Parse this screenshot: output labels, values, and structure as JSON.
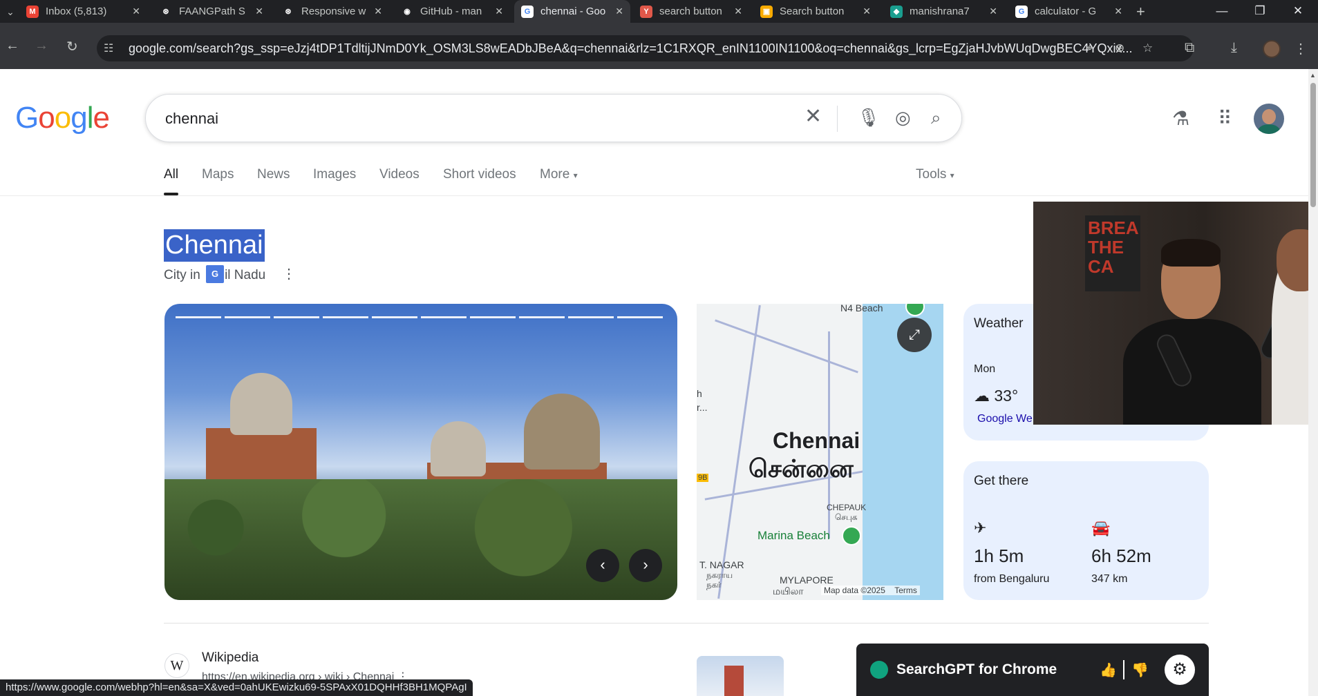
{
  "browser": {
    "tabs": [
      {
        "title": "Inbox (5,813)",
        "icon": "gmail-icon",
        "color": "#ea4335",
        "glyph": "M"
      },
      {
        "title": "FAANGPath S",
        "icon": "chatgpt-icon",
        "color": "#202124",
        "glyph": "⊛"
      },
      {
        "title": "Responsive w",
        "icon": "chatgpt-icon",
        "color": "#202124",
        "glyph": "⊛"
      },
      {
        "title": "GitHub - man",
        "icon": "github-icon",
        "color": "#202124",
        "glyph": "◉"
      },
      {
        "title": "chennai - Goo",
        "icon": "google-icon",
        "color": "#ffffff",
        "glyph": "G"
      },
      {
        "title": "search button",
        "icon": "y-icon",
        "color": "#e0584a",
        "glyph": "Y"
      },
      {
        "title": "Search button",
        "icon": "image-icon",
        "color": "#f9ab00",
        "glyph": "▣"
      },
      {
        "title": "manishrana7",
        "icon": "diamond-icon",
        "color": "#1a9e8f",
        "glyph": "◆"
      },
      {
        "title": "calculator - G",
        "icon": "google-icon",
        "color": "#ffffff",
        "glyph": "G"
      }
    ],
    "url": "google.com/search?gs_ssp=eJzj4tDP1TdltijJNmD0Yk_OSM3LS8wEADbJBeA&q=chennai&rlz=1C1RXQR_enIN1100IN1100&oq=chennai&gs_lcrp=EgZjaHJvbWUqDwgBEC4YQxix..."
  },
  "google": {
    "logo": "Google",
    "query": "chennai",
    "tabs": [
      "All",
      "Maps",
      "News",
      "Images",
      "Videos",
      "Short videos",
      "More"
    ],
    "tools": "Tools"
  },
  "entity": {
    "title": "Chennai",
    "subtitle_prefix": "City in",
    "subtitle_suffix": "il Nadu"
  },
  "map": {
    "city_en": "Chennai",
    "city_ta": "சென்னை",
    "beach_top": "N4 Beach",
    "chepauk": "CHEPAUK",
    "chepauk_ta": "செபுக",
    "marina": "Marina Beach",
    "nagar": "NAGAR",
    "nagar_ta": "நகராய",
    "nagar_ta2": "நகர்",
    "mylapore": "MYLAPORE",
    "mylapore_ta": "மயிலா",
    "road_badge": "9B",
    "left_h": "h",
    "left_r": "r...",
    "left_t": "T.",
    "attribution": "Map data ©2025",
    "terms": "Terms"
  },
  "weather": {
    "heading": "Weather",
    "day": "Mon",
    "temp": "33°",
    "source": "Google We"
  },
  "get_there": {
    "heading": "Get there",
    "flight_time": "1h 5m",
    "flight_from": "from Bengaluru",
    "drive_time": "6h 52m",
    "drive_distance": "347 km"
  },
  "video_overlay": {
    "sign": "BREA\nTHE\nCA"
  },
  "result": {
    "site": "Wikipedia",
    "url": "https://en.wikipedia.org › wiki › Chennai"
  },
  "searchgpt": {
    "title": "SearchGPT for Chrome"
  },
  "status_url": "https://www.google.com/webhp?hl=en&sa=X&ved=0ahUKEwizku69-5SPAxX01DQHHf3BH1MQPAgI"
}
